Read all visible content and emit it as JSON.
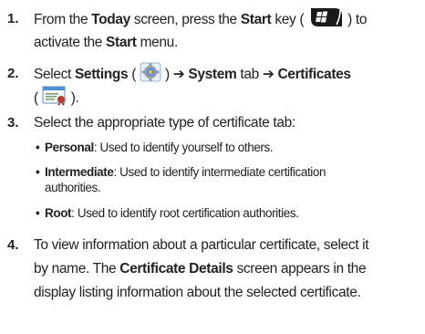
{
  "steps": [
    {
      "number": "1.",
      "line1": {
        "a": "From the ",
        "b": "Today",
        "c": " screen, press the ",
        "d": "Start",
        "e": " key (",
        "f": ") to"
      },
      "line2": {
        "a": "activate the ",
        "b": "Start",
        "c": " menu."
      }
    },
    {
      "number": "2.",
      "line1": {
        "a": "Select ",
        "b": "Settings",
        "c": " (",
        "d": ") ",
        "arrow1": "➔",
        "e": " System",
        "f": " tab ",
        "arrow2": "➔",
        "g": " Certificates"
      },
      "line2": {
        "a": "(",
        "b": ")."
      }
    },
    {
      "number": "3.",
      "line1": "Select the appropriate type of certificate tab:",
      "bullets": [
        {
          "term": "Personal",
          "desc": ": Used to identify yourself to others."
        },
        {
          "term": "Intermediate",
          "desc": ": Used to identify intermediate certification",
          "cont": "authorities."
        },
        {
          "term": "Root",
          "desc": ": Used to identify root certification authorities."
        }
      ]
    },
    {
      "number": "4.",
      "line1": "To view information about a particular certificate, select it",
      "line2": {
        "a": "by name. The ",
        "b": "Certificate Details",
        "c": " screen appears in the"
      },
      "line3": "display listing information about the selected certificate."
    }
  ],
  "icons": {
    "start_key": "windows-start-key-icon",
    "settings": "settings-gear-icon",
    "certificates": "certificate-icon"
  },
  "colors": {
    "text": "#222222",
    "cert_seal": "#c0392b",
    "settings_blue": "#5b8ed6"
  }
}
